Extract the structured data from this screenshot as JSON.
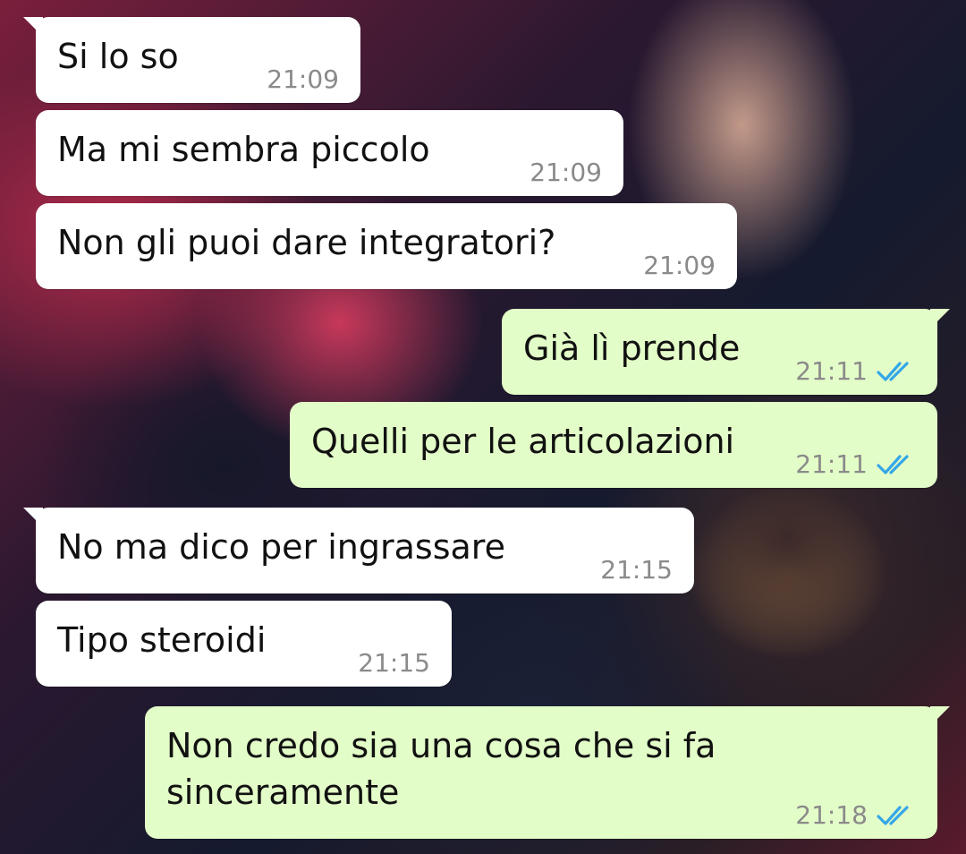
{
  "chat": {
    "messages": [
      {
        "direction": "incoming",
        "text": "Si lo so",
        "time": "21:09"
      },
      {
        "direction": "incoming",
        "text": "Ma mi sembra piccolo",
        "time": "21:09"
      },
      {
        "direction": "incoming",
        "text": "Non gli puoi dare integratori?",
        "time": "21:09"
      },
      {
        "direction": "outgoing",
        "text": "Già lì prende",
        "time": "21:11",
        "status": "read"
      },
      {
        "direction": "outgoing",
        "text": "Quelli per le articolazioni",
        "time": "21:11",
        "status": "read"
      },
      {
        "direction": "incoming",
        "text": "No ma dico per ingrassare",
        "time": "21:15"
      },
      {
        "direction": "incoming",
        "text": "Tipo steroidi",
        "time": "21:15"
      },
      {
        "direction": "outgoing",
        "text": "Non credo sia una cosa che si fa sinceramente",
        "time": "21:18",
        "status": "read"
      }
    ]
  },
  "colors": {
    "incoming_bubble": "#ffffff",
    "outgoing_bubble": "#e3fdc8",
    "read_ticks": "#34a7e8",
    "timestamp": "#8a8a8a"
  },
  "icons": {
    "read_receipt": "double-check-icon"
  }
}
